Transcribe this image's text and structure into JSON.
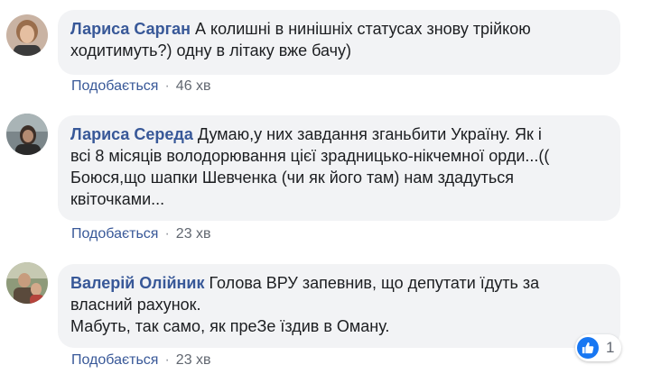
{
  "comments": [
    {
      "author": "Лариса Сарган",
      "lines": [
        "А колишні в нинішніх статусах знову трійкою",
        "ходитимуть?) одну в літаку вже бачу)"
      ],
      "like_label": "Подобається",
      "time": "46 хв"
    },
    {
      "author": "Лариса Середа",
      "lines": [
        "Думаю,у них завдання зганьбити Україну. Як і",
        "всі 8 місяців володорювання цієї зрадницько-нікчемної орди...((",
        "Боюся,що шапки Шевченка (чи як його там) нам здадуться",
        "квіточками..."
      ],
      "like_label": "Подобається",
      "time": "23 хв"
    },
    {
      "author": "Валерій Олійник",
      "lines": [
        "Голова ВРУ запевнив, що депутати їдуть за",
        "власний рахунок.",
        "Мабуть, так само, як преЗе їздив в Оману."
      ],
      "like_label": "Подобається",
      "time": "23 хв",
      "reactions": {
        "icon": "like-icon",
        "count": "1"
      }
    }
  ],
  "separator": "·",
  "colors": {
    "author": "#385898",
    "bubble": "#f2f3f5",
    "meta": "#616770",
    "like_badge": "#1877f2"
  }
}
